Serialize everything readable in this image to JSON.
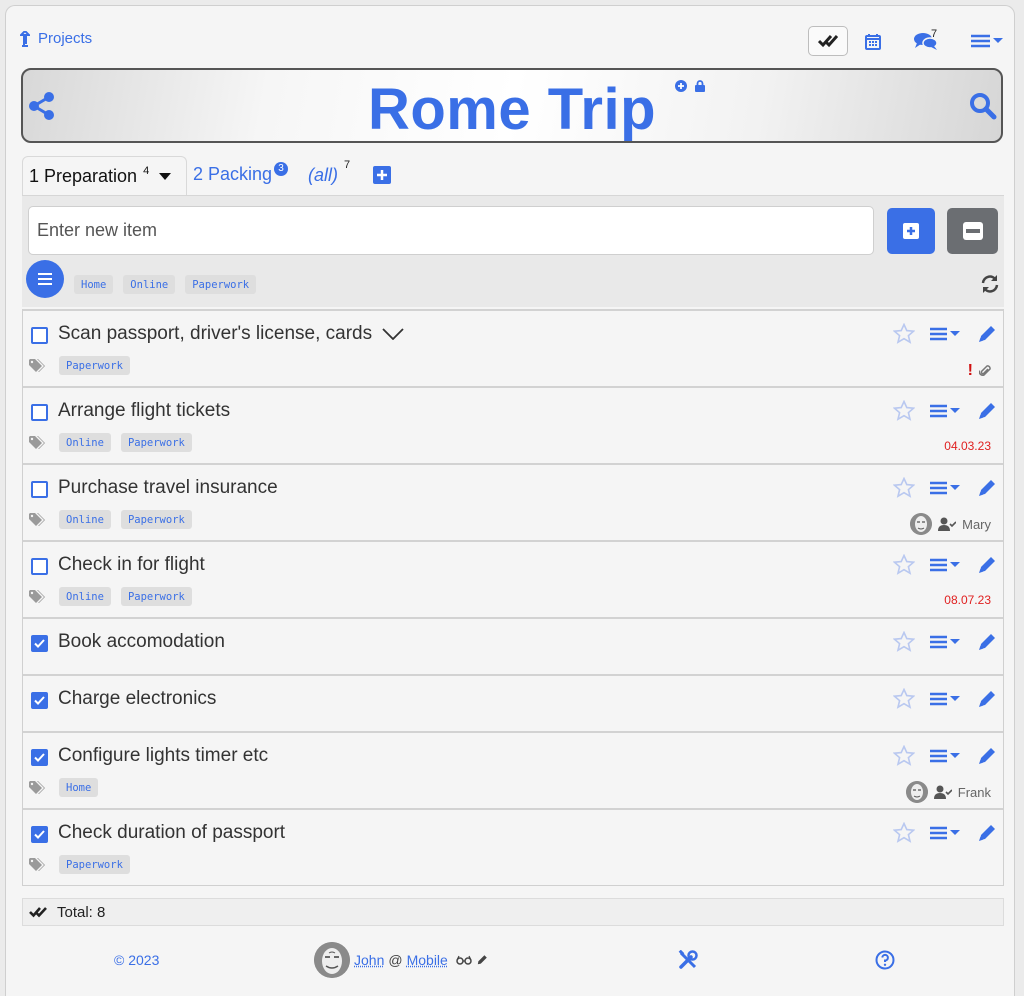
{
  "topbar": {
    "projects_label": "Projects",
    "chat_count": "7"
  },
  "header": {
    "title": "Rome Trip"
  },
  "tabs": [
    {
      "label": "1 Preparation",
      "count": "4",
      "active": true
    },
    {
      "label": "2 Packing",
      "count": "3"
    },
    {
      "label": "(all)",
      "count": "7"
    }
  ],
  "new_item": {
    "placeholder": "Enter new item"
  },
  "filter_tags": [
    "Home",
    "Online",
    "Paperwork"
  ],
  "items": [
    {
      "text": "Scan passport, driver's license, cards",
      "checked": false,
      "tags": [
        "Paperwork"
      ],
      "expandable": true,
      "meta": {
        "priority": "!",
        "attachment": true
      }
    },
    {
      "text": "Arrange flight tickets",
      "checked": false,
      "tags": [
        "Online",
        "Paperwork"
      ],
      "meta": {
        "date": "04.03.23"
      }
    },
    {
      "text": "Purchase travel insurance",
      "checked": false,
      "tags": [
        "Online",
        "Paperwork"
      ],
      "meta": {
        "assignee": "Mary"
      }
    },
    {
      "text": "Check in for flight",
      "checked": false,
      "tags": [
        "Online",
        "Paperwork"
      ],
      "meta": {
        "date": "08.07.23"
      }
    },
    {
      "text": "Book accomodation",
      "checked": true,
      "tags": []
    },
    {
      "text": "Charge electronics",
      "checked": true,
      "tags": []
    },
    {
      "text": "Configure lights timer etc",
      "checked": true,
      "tags": [
        "Home"
      ],
      "meta": {
        "assignee": "Frank"
      }
    },
    {
      "text": "Check duration of passport",
      "checked": true,
      "tags": [
        "Paperwork"
      ]
    }
  ],
  "total": {
    "label": "Total: 8"
  },
  "footer": {
    "copyright": "© 2023",
    "user_name": "John",
    "at": "@",
    "device": "Mobile"
  },
  "colors": {
    "accent": "#3a6fe6",
    "date_red": "#e02020",
    "priority_red": "#d01010"
  }
}
